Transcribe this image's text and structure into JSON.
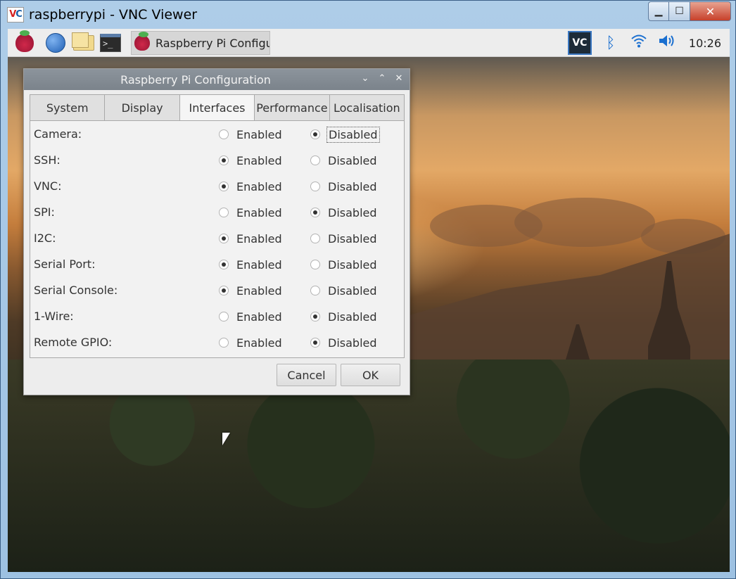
{
  "vnc": {
    "title": "raspberrypi - VNC Viewer",
    "logo": {
      "v": "V",
      "c": "C"
    },
    "min_symbol": "▁",
    "max_symbol": "☐",
    "close_symbol": "✕"
  },
  "taskbar": {
    "terminal_glyph": ">_",
    "task_label": "Raspberry Pi Configu...",
    "tray_vnc_label": "VC",
    "clock": "10:26"
  },
  "dialog": {
    "title": "Raspberry Pi Configuration",
    "controls": {
      "chevron_down": "⌄",
      "chevron_up": "⌃",
      "close": "✕"
    },
    "tabs": [
      "System",
      "Display",
      "Interfaces",
      "Performance",
      "Localisation"
    ],
    "active_tab": "Interfaces",
    "option_enabled": "Enabled",
    "option_disabled": "Disabled",
    "rows": [
      {
        "label": "Camera:",
        "value": "Disabled"
      },
      {
        "label": "SSH:",
        "value": "Enabled"
      },
      {
        "label": "VNC:",
        "value": "Enabled"
      },
      {
        "label": "SPI:",
        "value": "Disabled"
      },
      {
        "label": "I2C:",
        "value": "Enabled"
      },
      {
        "label": "Serial Port:",
        "value": "Enabled"
      },
      {
        "label": "Serial Console:",
        "value": "Enabled"
      },
      {
        "label": "1-Wire:",
        "value": "Disabled"
      },
      {
        "label": "Remote GPIO:",
        "value": "Disabled"
      }
    ],
    "cancel_label": "Cancel",
    "ok_label": "OK"
  },
  "colors": {
    "vnc_titlebar": "#aecde8",
    "dialog_titlebar": "#8c949c",
    "dialog_bg": "#ededed",
    "close_button": "#c7402a",
    "tray_blue": "#1a6fd0"
  }
}
